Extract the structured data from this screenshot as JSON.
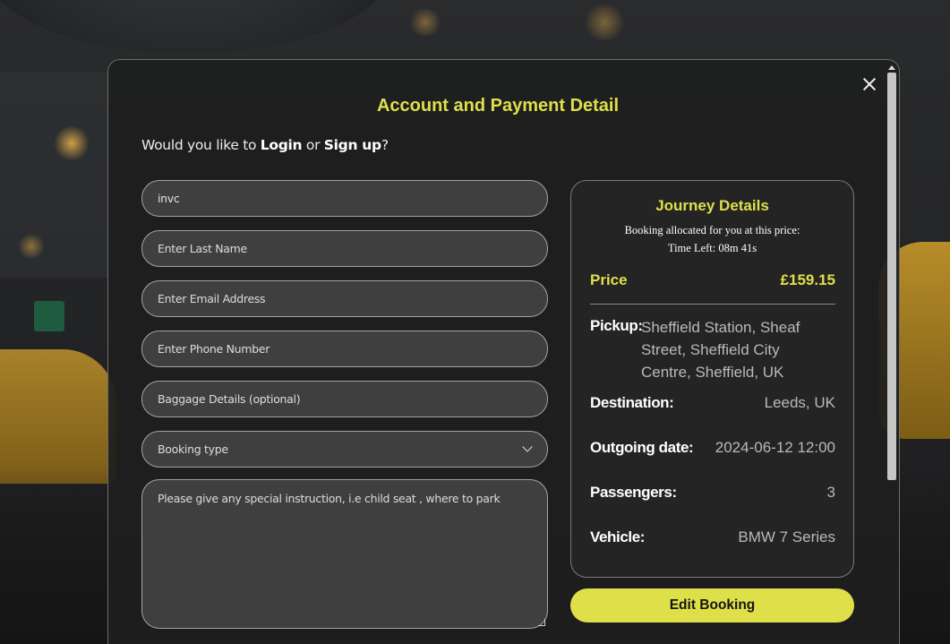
{
  "modal": {
    "title": "Account and Payment Detail",
    "question_prefix": "Would you like to ",
    "login_label": "Login",
    "question_or": " or ",
    "signup_label": "Sign up",
    "question_suffix": "?"
  },
  "form": {
    "first_name_value": "invc",
    "last_name_placeholder": "Enter Last Name",
    "email_placeholder": "Enter Email Address",
    "phone_placeholder": "Enter Phone Number",
    "baggage_placeholder": "Baggage Details (optional)",
    "booking_type_selected": "Booking type",
    "instructions_placeholder": "Please give any special instruction, i.e child seat , where to park"
  },
  "journey": {
    "title": "Journey Details",
    "allocated_note": "Booking allocated for you at this price:",
    "time_left": "Time Left: 08m 41s",
    "price_label": "Price",
    "price_value": "£159.15",
    "pickup_label": "Pickup:",
    "pickup_value": "Sheffield Station, Sheaf Street, Sheffield City Centre, Sheffield, UK",
    "destination_label": "Destination:",
    "destination_value": "Leeds, UK",
    "outgoing_label": "Outgoing date:",
    "outgoing_value": "2024-06-12 12:00",
    "passengers_label": "Passengers:",
    "passengers_value": "3",
    "vehicle_label": "Vehicle:",
    "vehicle_value": "BMW 7 Series"
  },
  "actions": {
    "edit_booking_label": "Edit Booking"
  },
  "colors": {
    "accent": "#dfe049",
    "modal_bg": "#1e1e1e",
    "text_primary": "#ffffff",
    "text_muted": "#b9b9b9"
  },
  "icons": {
    "close": "close-icon",
    "dropdown": "chevron-down-icon"
  }
}
